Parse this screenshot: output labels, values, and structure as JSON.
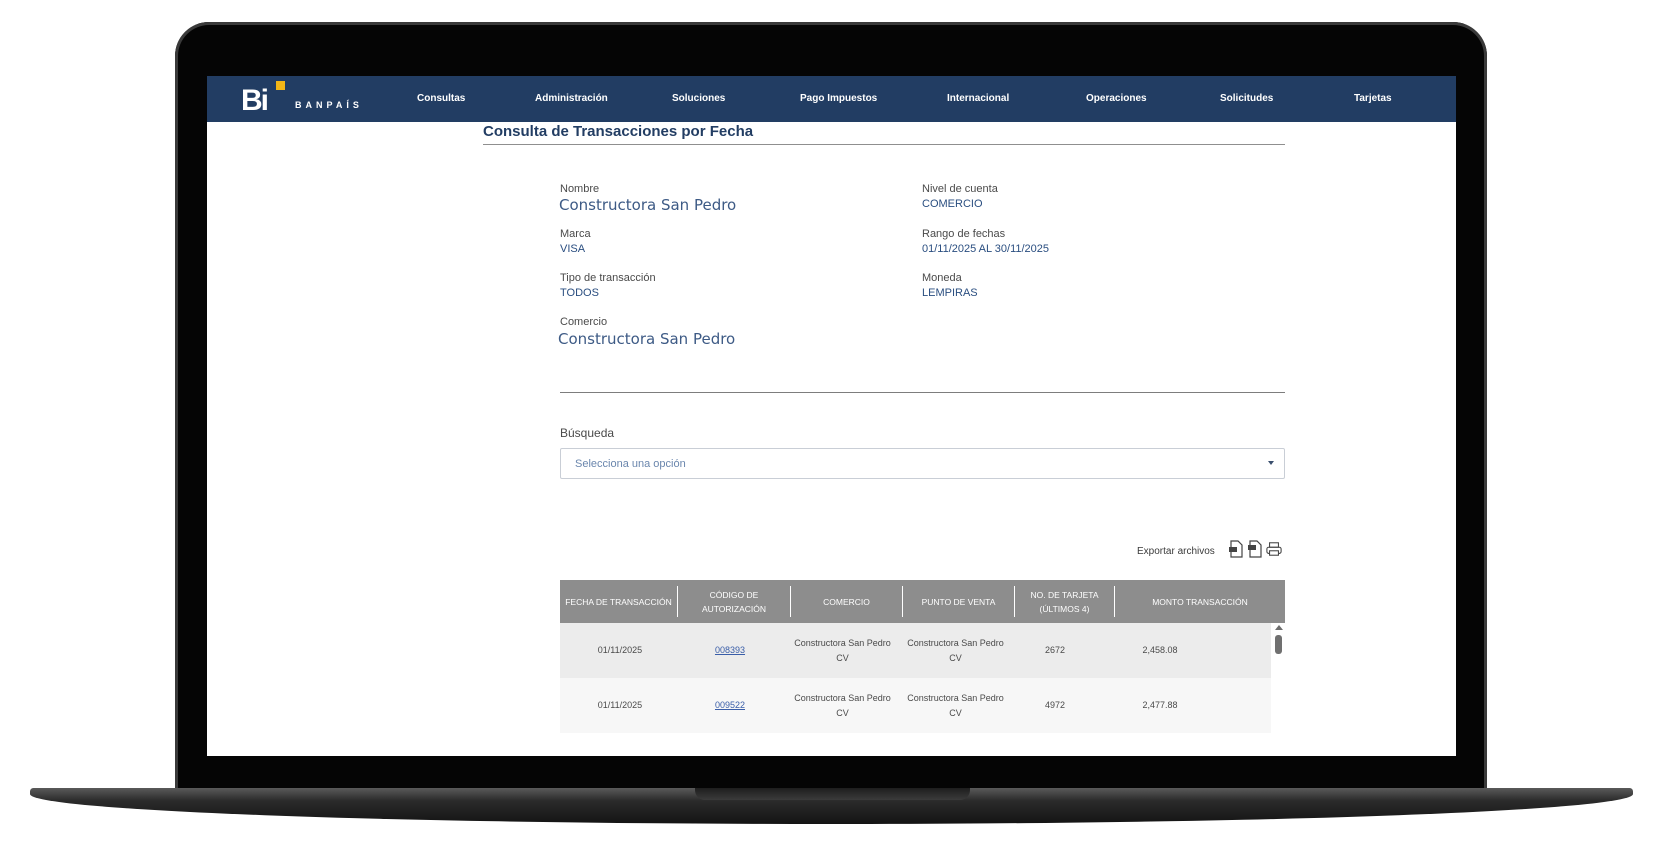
{
  "brand": {
    "logo_mark": "Bi",
    "logo_text": "BANPAÍS",
    "accent": "#f2b617",
    "nav_color": "#223d63"
  },
  "nav": {
    "items": [
      "Consultas",
      "Administración",
      "Soluciones",
      "Pago Impuestos",
      "Internacional",
      "Operaciones",
      "Solicitudes",
      "Tarjetas"
    ]
  },
  "page": {
    "title": "Consulta de Transacciones por Fecha"
  },
  "info": {
    "nombre_label": "Nombre",
    "nombre_value": "Constructora San Pedro",
    "nivel_label": "Nivel de cuenta",
    "nivel_value": "COMERCIO",
    "marca_label": "Marca",
    "marca_value": "VISA",
    "rango_label": "Rango de fechas",
    "rango_value": "01/11/2025 AL 30/11/2025",
    "tipo_label": "Tipo de transacción",
    "tipo_value": "TODOS",
    "moneda_label": "Moneda",
    "moneda_value": "LEMPIRAS",
    "comercio_label": "Comercio",
    "comercio_value": "Constructora San Pedro"
  },
  "search": {
    "label": "Búsqueda",
    "placeholder": "Selecciona una opción"
  },
  "export": {
    "label": "Exportar archivos",
    "icons": [
      "pdf-file-icon",
      "excel-file-icon",
      "print-icon"
    ]
  },
  "table": {
    "headers": [
      "FECHA DE TRANSACCIÓN",
      "CÓDIGO DE AUTORIZACIÓN",
      "COMERCIO",
      "PUNTO DE VENTA",
      "NO. DE TARJETA",
      "(ÚLTIMOS 4)",
      "MONTO TRANSACCIÓN"
    ],
    "rows": [
      {
        "fecha": "01/11/2025",
        "codigo": "008393",
        "comercio_1": "Constructora San Pedro",
        "comercio_2": "CV",
        "punto_1": "Constructora San Pedro",
        "punto_2": "CV",
        "tarjeta": "2672",
        "monto": "2,458.08"
      },
      {
        "fecha": "01/11/2025",
        "codigo": "009522",
        "comercio_1": "Constructora San Pedro",
        "comercio_2": "CV",
        "punto_1": "Constructora San Pedro",
        "punto_2": "CV",
        "tarjeta": "4972",
        "monto": "2,477.88"
      }
    ]
  }
}
